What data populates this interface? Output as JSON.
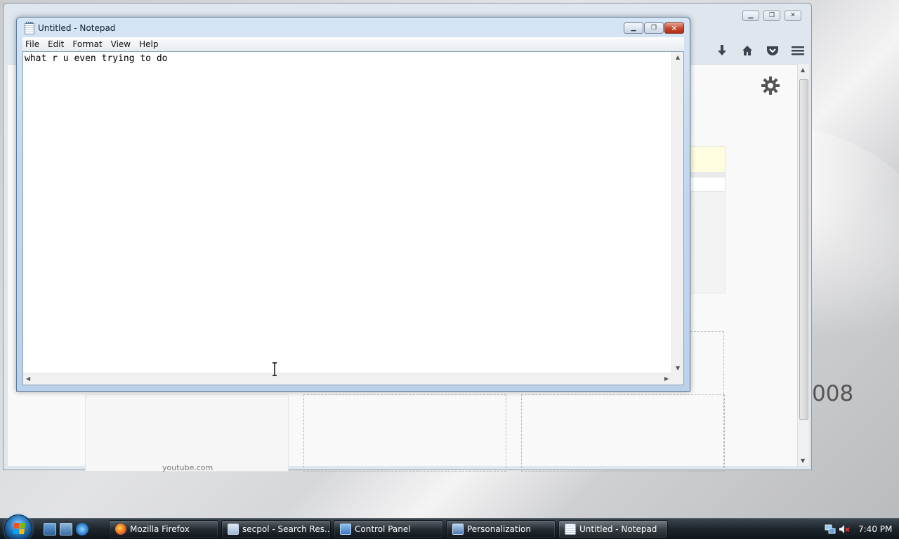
{
  "desktop": {
    "partial_text": "008"
  },
  "firefox": {
    "caption_buttons": [
      "minimize",
      "restore",
      "close"
    ],
    "toolbar_icons": [
      "download-icon",
      "home-icon",
      "pocket-icon",
      "menu-icon"
    ],
    "tile_caption": "youtube.com"
  },
  "notepad": {
    "title": "Untitled - Notepad",
    "menu": [
      "File",
      "Edit",
      "Format",
      "View",
      "Help"
    ],
    "content": "what r u even trying to do"
  },
  "taskbar": {
    "tasks": [
      {
        "label": "Mozilla Firefox",
        "icon": "firefox-icon",
        "active": false
      },
      {
        "label": "secpol - Search Res...",
        "icon": "search-results-icon",
        "active": false
      },
      {
        "label": "Control Panel",
        "icon": "control-panel-icon",
        "active": false
      },
      {
        "label": "Personalization",
        "icon": "personalization-icon",
        "active": false
      },
      {
        "label": "Untitled - Notepad",
        "icon": "notepad-icon",
        "active": true
      }
    ],
    "clock": "7:40 PM"
  }
}
